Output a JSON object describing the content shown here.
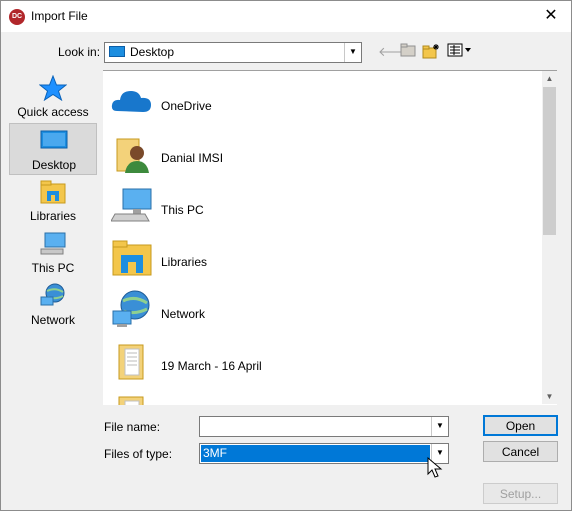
{
  "window": {
    "title": "Import File",
    "app_icon_text": "DC",
    "close_glyph": "✕"
  },
  "lookin": {
    "label": "Look in:",
    "value": "Desktop",
    "icon": "desktop-icon"
  },
  "toolbar": {
    "back_icon": "back-arrow-icon",
    "up_icon": "up-folder-icon",
    "new_folder_icon": "new-folder-icon",
    "view_menu_icon": "view-menu-icon"
  },
  "places": [
    {
      "label": "Quick access",
      "icon": "star-icon",
      "selected": false
    },
    {
      "label": "Desktop",
      "icon": "desktop-icon",
      "selected": true
    },
    {
      "label": "Libraries",
      "icon": "libraries-icon",
      "selected": false
    },
    {
      "label": "This PC",
      "icon": "computer-icon",
      "selected": false
    },
    {
      "label": "Network",
      "icon": "network-icon",
      "selected": false
    }
  ],
  "files": [
    {
      "name": "OneDrive",
      "icon": "cloud-icon"
    },
    {
      "name": "Danial IMSI",
      "icon": "user-folder-icon"
    },
    {
      "name": "This PC",
      "icon": "computer-icon"
    },
    {
      "name": "Libraries",
      "icon": "libraries-folder-icon"
    },
    {
      "name": "Network",
      "icon": "network-icon"
    },
    {
      "name": "19 March - 16 April",
      "icon": "folder-icon"
    },
    {
      "name": "",
      "icon": "folder-icon"
    }
  ],
  "form": {
    "file_name_label": "File name:",
    "file_name_value": "",
    "file_type_label": "Files of type:",
    "file_type_value": "3MF"
  },
  "buttons": {
    "open": "Open",
    "cancel": "Cancel",
    "setup": "Setup..."
  },
  "colors": {
    "selection": "#0078d7",
    "accent_blue": "#1c8ee0",
    "folder": "#f3c64b"
  }
}
